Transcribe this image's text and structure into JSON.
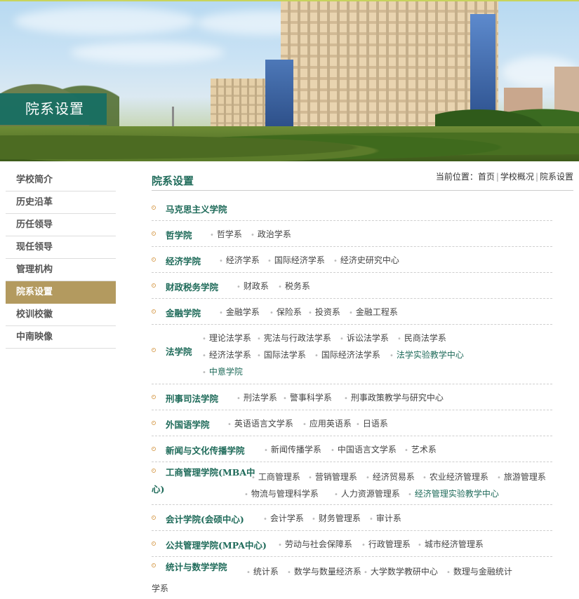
{
  "banner": {
    "title": "院系设置"
  },
  "sidebar": {
    "items": [
      {
        "label": "学校简介"
      },
      {
        "label": "历史沿革"
      },
      {
        "label": "历任领导"
      },
      {
        "label": "现任领导"
      },
      {
        "label": "管理机构"
      },
      {
        "label": "院系设置",
        "active": true
      },
      {
        "label": "校训校徽"
      },
      {
        "label": "中南映像"
      }
    ]
  },
  "main": {
    "title": "院系设置",
    "breadcrumb": {
      "prefix": "当前位置：",
      "items": [
        "首页",
        "学校概况",
        "院系设置"
      ]
    }
  },
  "colleges": [
    {
      "name": "马克思主义学院",
      "depts": []
    },
    {
      "name": "哲学院",
      "depts": [
        "哲学系",
        "政治学系"
      ]
    },
    {
      "name": "经济学院",
      "depts": [
        "经济学系",
        "国际经济学系",
        "经济史研究中心"
      ]
    },
    {
      "name": "财政税务学院",
      "depts": [
        "财政系",
        "税务系"
      ]
    },
    {
      "name": "金融学院",
      "depts": [
        "金融学系",
        "保险系",
        "投资系",
        "金融工程系"
      ]
    },
    {
      "name": "法学院",
      "depts": [
        "理论法学系",
        "宪法与行政法学系",
        "诉讼法学系",
        "民商法学系",
        "经济法学系",
        "国际法学系",
        "国际经济法学系",
        "法学实验教学中心",
        "中意学院"
      ]
    },
    {
      "name": "刑事司法学院",
      "depts": [
        "刑法学系",
        "警事科学系",
        "刑事政策教学与研究中心"
      ]
    },
    {
      "name": "外国语学院",
      "depts": [
        "英语语言文学系",
        "应用英语系",
        "日语系"
      ]
    },
    {
      "name": "新闻与文化传播学院",
      "depts": [
        "新闻传播学系",
        "中国语言文学系",
        "艺术系"
      ]
    },
    {
      "name": "工商管理学院(MBA中",
      "name_cont": "心)",
      "depts": [
        "工商管理系",
        "营销管理系",
        "经济贸易系",
        "农业经济管理系",
        "旅游管理系",
        "物流与管理科学系",
        "人力资源管理系",
        "经济管理实验教学中心"
      ]
    },
    {
      "name": "会计学院(会硕中心)",
      "depts": [
        "会计学系",
        "财务管理系",
        "审计系"
      ]
    },
    {
      "name": "公共管理学院(MPA中心)",
      "depts": [
        "劳动与社会保障系",
        "行政管理系",
        "城市经济管理系"
      ]
    },
    {
      "name": "统计与数学学院",
      "depts": [
        "统计系",
        "数学与数量经济系",
        "大学数学教研中心",
        "数理与金融统计"
      ],
      "dept_cont": "学系"
    }
  ]
}
